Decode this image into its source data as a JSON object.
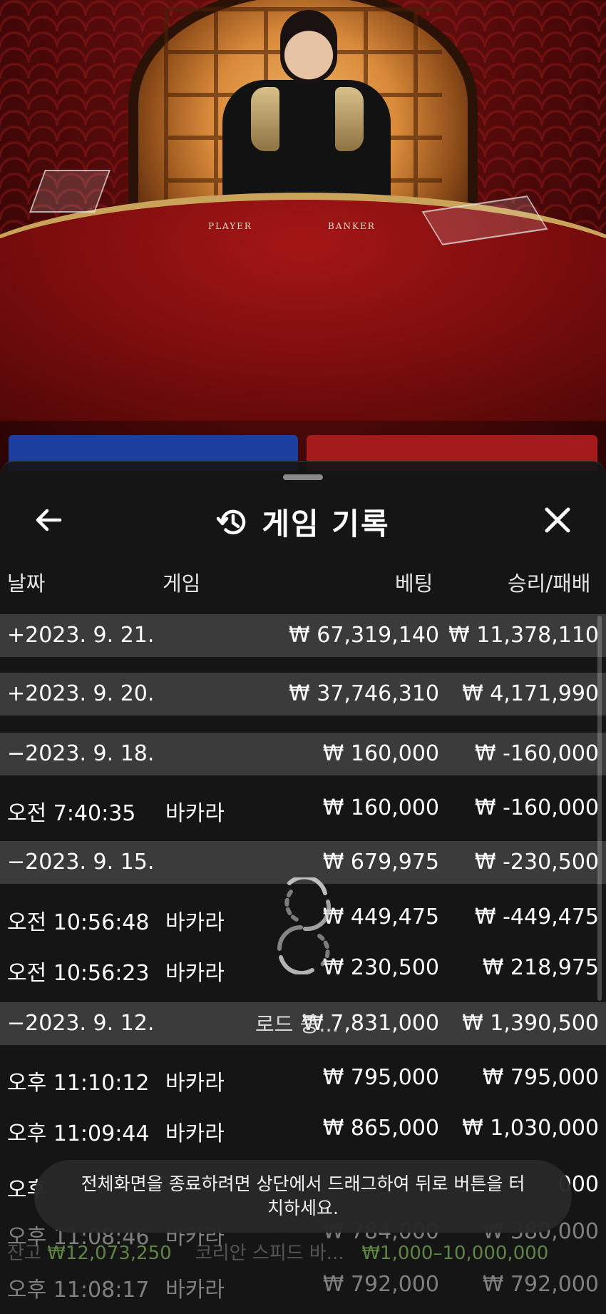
{
  "video": {
    "table_labels": {
      "player": "PLAYER",
      "banker": "BANKER"
    }
  },
  "sheet": {
    "title": "게임 기록",
    "icons": {
      "back": "arrow-left-icon",
      "history": "history-clock-icon",
      "close": "close-x-icon"
    },
    "columns": {
      "date": "날짜",
      "game": "게임",
      "bet": "베팅",
      "result": "승리/패배"
    },
    "rows": [
      {
        "type": "date",
        "c0": "+2023. 9. 21.",
        "c1": "",
        "c2": "₩ 67,319,140",
        "c3": "₩ 11,378,110"
      },
      {
        "type": "date",
        "c0": "+2023. 9. 20.",
        "c1": "",
        "c2": "₩ 37,746,310",
        "c3": "₩ 4,171,990"
      },
      {
        "type": "date",
        "c0": "−2023. 9. 18.",
        "c1": "",
        "c2": "₩ 160,000",
        "c3": "₩ -160,000"
      },
      {
        "type": "game",
        "c0": "오전 7:40:35",
        "c1": "바카라",
        "c2": "₩ 160,000",
        "c3": "₩ -160,000"
      },
      {
        "type": "date",
        "c0": "−2023. 9. 15.",
        "c1": "",
        "c2": "₩ 679,975",
        "c3": "₩ -230,500"
      },
      {
        "type": "game",
        "c0": "오전 10:56:48",
        "c1": "바카라",
        "c2": "₩ 449,475",
        "c3": "₩ -449,475"
      },
      {
        "type": "game",
        "c0": "오전 10:56:23",
        "c1": "바카라",
        "c2": "₩ 230,500",
        "c3": "₩ 218,975"
      },
      {
        "type": "date",
        "c0": "−2023. 9. 12.",
        "c1": "",
        "c2": "₩ 7,831,000",
        "c3": "₩ 1,390,500"
      },
      {
        "type": "game",
        "c0": "오후 11:10:12",
        "c1": "바카라",
        "c2": "₩ 795,000",
        "c3": "₩ 795,000"
      },
      {
        "type": "game",
        "c0": "오후 11:09:44",
        "c1": "바카라",
        "c2": "₩ 865,000",
        "c3": "₩ 1,030,000"
      },
      {
        "type": "game",
        "c0": "오후",
        "c1": "",
        "c2": "",
        "c3": "000"
      },
      {
        "type": "game",
        "c0": "오후 11:08:46",
        "c1": "바카라",
        "c2": "₩ 784,000",
        "c3": "₩ 380,000"
      },
      {
        "type": "game",
        "c0": "오후 11:08:17",
        "c1": "바카라",
        "c2": "₩ 792,000",
        "c3": "₩ 792,000"
      }
    ]
  },
  "loading": {
    "text": "로드 중..."
  },
  "toast": {
    "text": "전체화면을 종료하려면 상단에서 드래그하여 뒤로 버튼을 터치하세요."
  },
  "bottom_bar": {
    "balance_label": "잔고",
    "balance": "₩12,073,250",
    "game_name": "코리안 스피드 바...",
    "limits": "₩1,000–10,000,000"
  },
  "colors": {
    "player": "#1c3fa0",
    "banker": "#a51a1a",
    "sheet": "#161616",
    "row_highlight": "#464646"
  }
}
